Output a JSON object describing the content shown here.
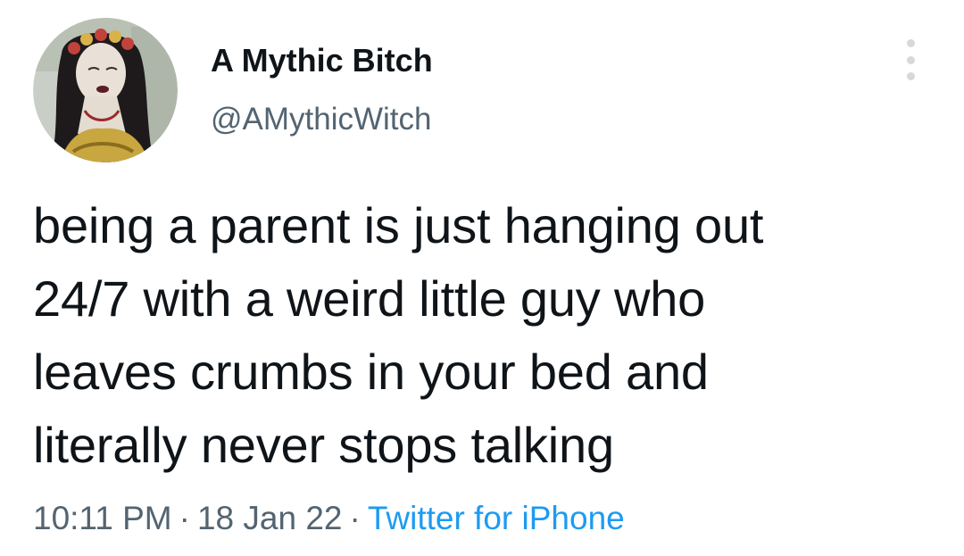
{
  "author": {
    "display_name": "A Mythic Bitch",
    "handle": "@AMythicWitch"
  },
  "tweet": {
    "lines": [
      "being a parent is just hanging out",
      "24/7 with a weird little guy who",
      "leaves crumbs in your bed and",
      "literally never stops talking"
    ]
  },
  "meta": {
    "time": "10:11 PM",
    "separator": "·",
    "date": "18 Jan 22",
    "source": "Twitter for iPhone",
    "source_color": "#1d9bf0"
  },
  "icons": {
    "more": "more-options-icon"
  }
}
